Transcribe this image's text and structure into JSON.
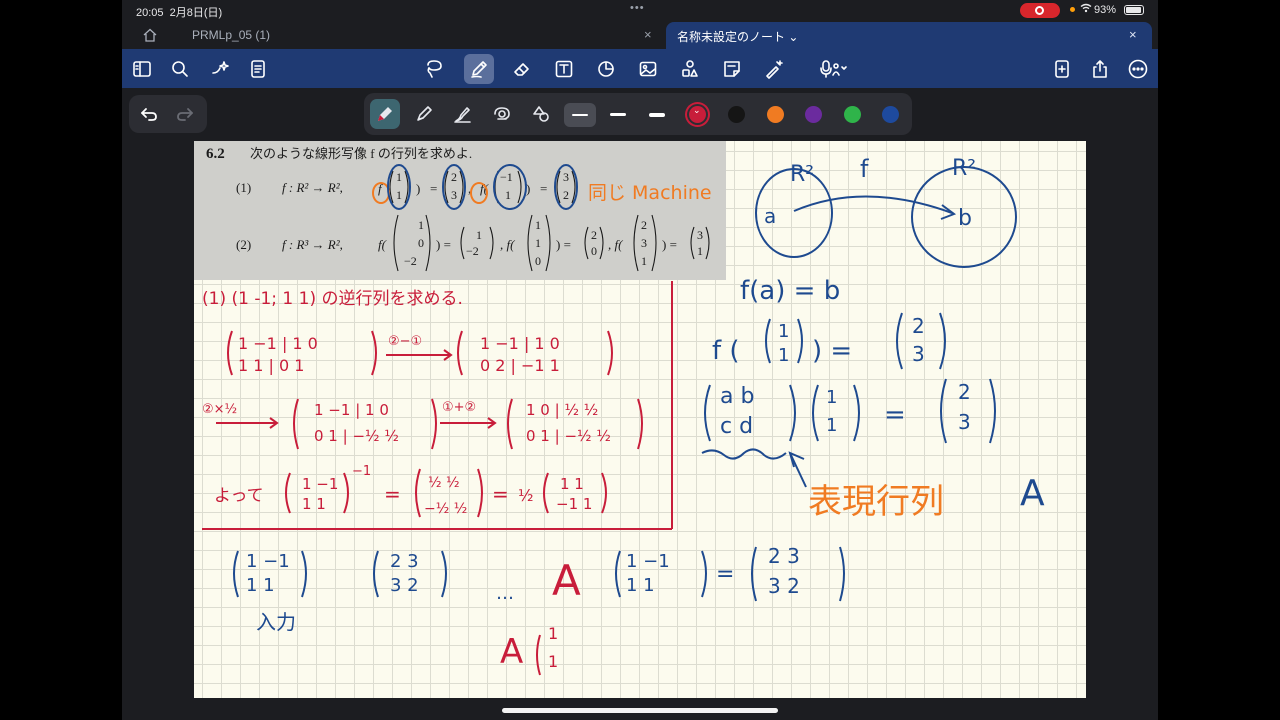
{
  "status_bar": {
    "time": "20:05",
    "date": "2月8日(日)",
    "battery": "93%",
    "dots": "•••"
  },
  "tabs": [
    {
      "label": "PRMLp_05 (1)",
      "close": "×"
    },
    {
      "label": "名称未設定のノート ⌄",
      "close": "×"
    }
  ],
  "colors": {
    "toolbar_bg": "#1f3a73",
    "ink_red": "#c81d3a",
    "ink_blue": "#1e4a8f",
    "ink_orange": "#f07b22",
    "page_bg": "#fcfbee"
  },
  "toolbar_icons": [
    "sidebar-icon",
    "search-icon",
    "sparkle-icon",
    "document-icon",
    "lasso-icon",
    "pen-icon",
    "eraser-icon",
    "textbox-icon",
    "shapes-icon",
    "image-icon",
    "stickers-icon",
    "note-icon",
    "magic-icon",
    "microphone-icon",
    "add-page-icon",
    "share-icon",
    "more-icon"
  ],
  "pen_colors": [
    "#c81d3a",
    "#151515",
    "#f07b22",
    "#6b2b9e",
    "#2fb44a",
    "#1e4a9e"
  ],
  "problem": {
    "number": "6.2",
    "instruction": "次のような線形写像 f の行列を求めよ.",
    "part1_label": "(1)",
    "part1_map": "f : R² → R²,",
    "part2_label": "(2)",
    "part2_map": "f : R³ → R²,"
  },
  "handwriting": {
    "orange_note": "同じ Machine",
    "red_heading": "(1) (1 -1; 1 1) の逆行列を求める.",
    "red_step1": "②−①",
    "red_step2": "②×½",
    "red_step3": "①+②",
    "red_conclusion": "よって",
    "blue_set": "R²",
    "blue_f": "f",
    "blue_a": "a",
    "blue_b": "b",
    "blue_eq": "f(a) = b",
    "orange_label": "表現行列",
    "matrix_symbol": "A",
    "input_label": "入力",
    "ellipsis": "…",
    "letters_ab": "a  b",
    "letters_cd": "c  d"
  }
}
